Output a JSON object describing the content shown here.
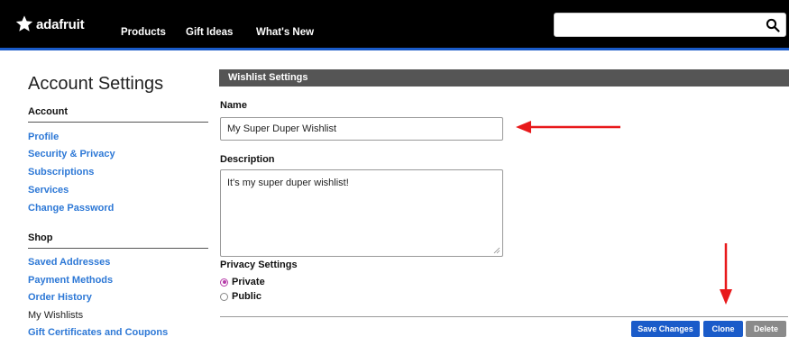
{
  "header": {
    "logo_text": "adafruit",
    "nav": [
      "Products",
      "Gift Ideas",
      "What's New"
    ],
    "search": {
      "value": "",
      "placeholder": ""
    }
  },
  "sidebar": {
    "title": "Account Settings",
    "sections": [
      {
        "heading": "Account",
        "items": [
          "Profile",
          "Security & Privacy",
          "Subscriptions",
          "Services",
          "Change Password"
        ]
      },
      {
        "heading": "Shop",
        "items": [
          "Saved Addresses",
          "Payment Methods",
          "Order History",
          "My Wishlists",
          "Gift Certificates and Coupons"
        ]
      }
    ],
    "current_item": "My Wishlists"
  },
  "main": {
    "panel_title": "Wishlist Settings",
    "name_label": "Name",
    "name_value": "My Super Duper Wishlist",
    "description_label": "Description",
    "description_value": "It's my super duper wishlist!",
    "privacy_label": "Privacy Settings",
    "privacy_options": [
      {
        "label": "Private",
        "checked": true
      },
      {
        "label": "Public",
        "checked": false
      }
    ],
    "buttons": {
      "save": "Save Changes",
      "clone": "Clone",
      "delete": "Delete"
    }
  },
  "colors": {
    "accent_blue": "#1a5bc9",
    "link_blue": "#2d78d6",
    "header_bg": "#000000",
    "panel_header_bg": "#555555",
    "annotation_red": "#e8191b",
    "radio_selected": "#b53aa8"
  }
}
